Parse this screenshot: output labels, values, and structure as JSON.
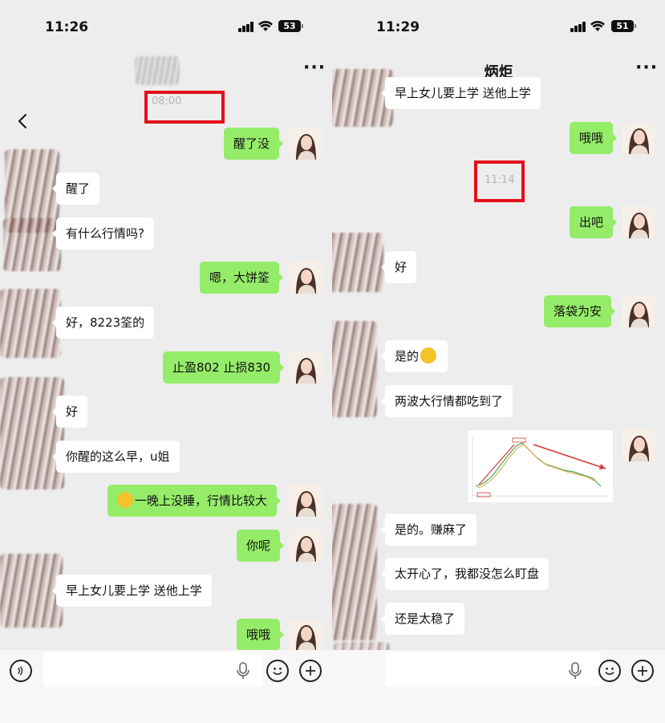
{
  "left": {
    "status": {
      "time": "11:26",
      "battery": "53"
    },
    "timestamp": "08:00",
    "messages": [
      {
        "id": "m1",
        "side": "me",
        "text": "醒了没"
      },
      {
        "id": "m2",
        "side": "other",
        "text": "醒了"
      },
      {
        "id": "m3",
        "side": "other",
        "text": "有什么行情吗?"
      },
      {
        "id": "m4",
        "side": "me",
        "text": "嗯，大饼筌"
      },
      {
        "id": "m5",
        "side": "other",
        "text": "好，8223筌的"
      },
      {
        "id": "m6",
        "side": "me",
        "text": "止盈802 止损830"
      },
      {
        "id": "m7",
        "side": "other",
        "text": "好"
      },
      {
        "id": "m8",
        "side": "other",
        "text": "你醒的这么早，u姐"
      },
      {
        "id": "m9",
        "side": "me",
        "text": "一晚上没睡，行情比较大"
      },
      {
        "id": "m10",
        "side": "me",
        "text": "你呢"
      },
      {
        "id": "m11",
        "side": "other",
        "text": "早上女儿要上学 送他上学"
      },
      {
        "id": "m12",
        "side": "me",
        "text": "哦哦"
      }
    ]
  },
  "right": {
    "status": {
      "time": "11:29",
      "battery": "51"
    },
    "title": "炳炬",
    "timestamp": "11:14",
    "messages": [
      {
        "id": "r0",
        "side": "other",
        "text": "早上女儿要上学 送他上学"
      },
      {
        "id": "r1",
        "side": "me",
        "text": "哦哦"
      },
      {
        "id": "r2",
        "side": "me",
        "text": "出吧"
      },
      {
        "id": "r3",
        "side": "other",
        "text": "好"
      },
      {
        "id": "r4",
        "side": "me",
        "text": "落袋为安"
      },
      {
        "id": "r5",
        "side": "other",
        "text": "是的"
      },
      {
        "id": "r6",
        "side": "other",
        "text": "两波大行情都吃到了"
      },
      {
        "id": "r7",
        "side": "other",
        "text": "是的。赚麻了"
      },
      {
        "id": "r8",
        "side": "other",
        "text": "太开心了，我都没怎么盯盘"
      },
      {
        "id": "r9",
        "side": "other",
        "text": "还是太稳了"
      }
    ]
  },
  "colors": {
    "my_bubble": "#95ec69",
    "their_bubble": "#ffffff",
    "background": "#ededed",
    "highlight_box": "#e30f1a"
  },
  "icons": {
    "back": "chevron-left-icon",
    "more": "more-dots-icon",
    "voice": "voice-icon",
    "mic": "mic-icon",
    "emoji": "emoji-icon",
    "add": "plus-icon"
  }
}
